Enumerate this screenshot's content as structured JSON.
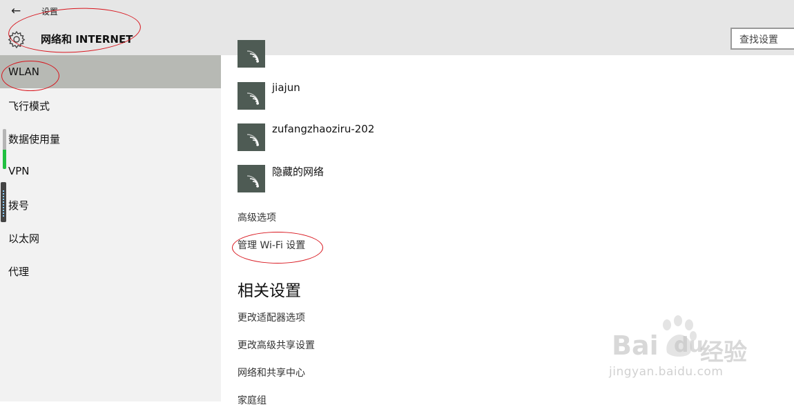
{
  "header": {
    "app_title": "设置",
    "section_title": "网络和 INTERNET",
    "search_placeholder": "查找设置"
  },
  "sidebar": {
    "items": [
      {
        "label": "WLAN",
        "active": true
      },
      {
        "label": "飞行模式"
      },
      {
        "label": "数据使用量"
      },
      {
        "label": "VPN"
      },
      {
        "label": "拨号"
      },
      {
        "label": "以太网"
      },
      {
        "label": "代理"
      }
    ]
  },
  "networks": [
    {
      "name": ""
    },
    {
      "name": "jiajun"
    },
    {
      "name": "zufangzhaoziru-202"
    },
    {
      "name": "隐藏的网络"
    }
  ],
  "links": {
    "advanced": "高级选项",
    "manage_wifi": "管理 Wi-Fi 设置"
  },
  "related": {
    "heading": "相关设置",
    "items": [
      "更改适配器选项",
      "更改高级共享设置",
      "网络和共享中心",
      "家庭组"
    ]
  },
  "watermark": {
    "brand_a": "Bai",
    "brand_b": "du",
    "brand_c": "经验",
    "url": "jingyan.baidu.com"
  },
  "icons": {
    "back": "back-arrow-icon",
    "settings": "gear-icon",
    "wifi": "wifi-signal-icon"
  },
  "colors": {
    "header_bg": "#e6e6e6",
    "sidebar_bg": "#f2f2f2",
    "sidebar_active": "#b7b9b4",
    "wifi_tile": "#4e5b54",
    "annotation": "#d8131b"
  }
}
